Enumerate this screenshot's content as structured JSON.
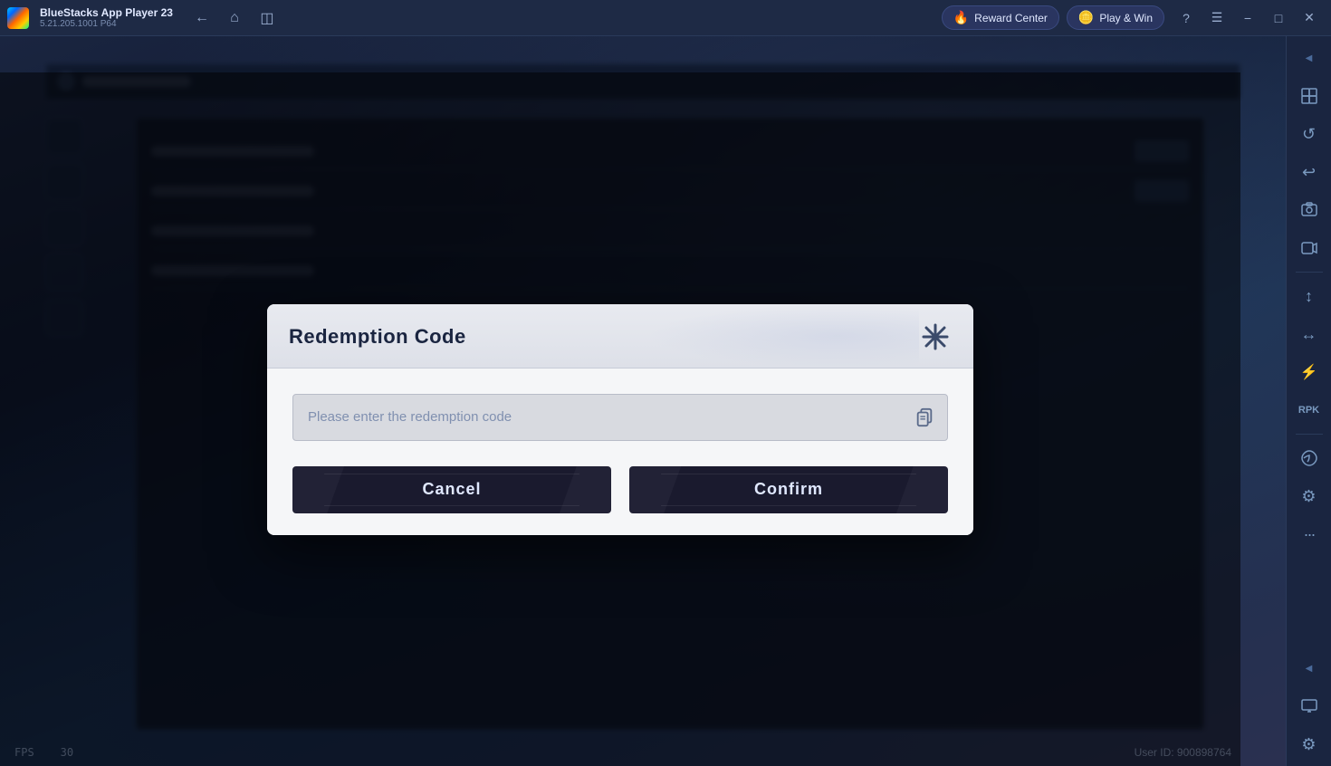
{
  "titlebar": {
    "app_name": "BlueStacks App Player 23",
    "app_version": "5.21.205.1001 P64",
    "reward_center_label": "Reward Center",
    "play_win_label": "Play & Win"
  },
  "dialog": {
    "title": "Redemption Code",
    "input_placeholder": "Please enter the redemption code",
    "cancel_label": "Cancel",
    "confirm_label": "Confirm"
  },
  "right_sidebar": {
    "icons": [
      "◀",
      "⊞",
      "↺",
      "↩",
      "⊡",
      "📷",
      "🖼",
      "↕",
      "↔",
      "✦",
      "⚙",
      "•••",
      "◀",
      "🖥",
      "⚙"
    ]
  },
  "footer": {
    "fps_label": "FPS",
    "fps_value": "30",
    "user_id_label": "User ID: 900898764"
  }
}
